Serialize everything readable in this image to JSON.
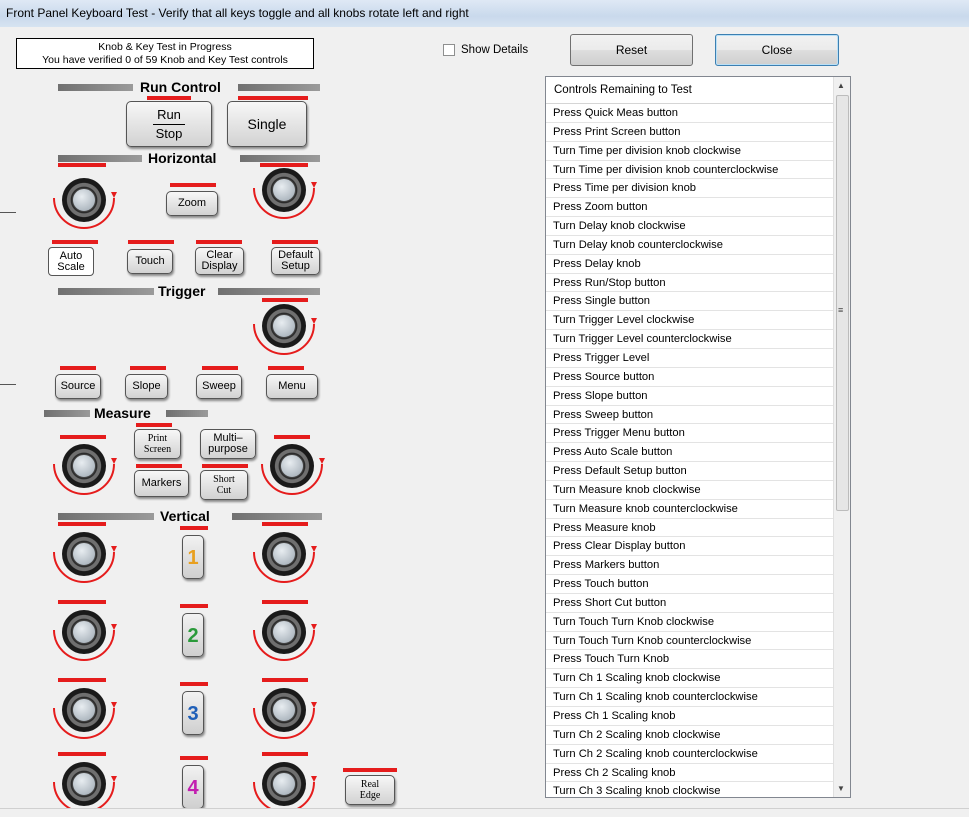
{
  "window": {
    "title": "Front Panel Keyboard Test  - Verify that all keys toggle and all knobs rotate left and right"
  },
  "status": {
    "line1": "Knob & Key Test in Progress",
    "line2": "You have verified 0 of 59 Knob and Key Test controls"
  },
  "show_details": {
    "label": "Show Details",
    "checked": false
  },
  "buttons": {
    "reset": "Reset",
    "close": "Close"
  },
  "panel": {
    "run_control": "Run Control",
    "run": "Run",
    "stop": "Stop",
    "single": "Single",
    "horizontal": "Horizontal",
    "zoom": "Zoom",
    "auto": "Auto",
    "scale": "Scale",
    "touch": "Touch",
    "clear": "Clear",
    "display": "Display",
    "default": "Default",
    "setup": "Setup",
    "trigger": "Trigger",
    "source": "Source",
    "slope": "Slope",
    "sweep": "Sweep",
    "menu": "Menu",
    "measure": "Measure",
    "print": "Print",
    "screen": "Screen",
    "multi": "Multi–",
    "purpose": "purpose",
    "markers": "Markers",
    "short": "Short",
    "cut": "Cut",
    "vertical": "Vertical",
    "ch1": "1",
    "ch2": "2",
    "ch3": "3",
    "ch4": "4",
    "real": "Real",
    "edge": "Edge"
  },
  "colors": {
    "ch1": "#e8a020",
    "ch2": "#2a9a3a",
    "ch3": "#1f5fb8",
    "ch4": "#c21fb0",
    "indicator": "#e51c1c"
  },
  "list": {
    "header": "Controls Remaining to Test",
    "items": [
      "Press Quick Meas button",
      "Press Print Screen button",
      "Turn Time per division knob clockwise",
      "Turn Time per division knob counterclockwise",
      "Press Time per division knob",
      "Press Zoom button",
      "Turn Delay knob clockwise",
      "Turn Delay knob counterclockwise",
      "Press Delay knob",
      "Press Run/Stop button",
      "Press Single button",
      "Turn Trigger Level clockwise",
      "Turn Trigger Level counterclockwise",
      "Press Trigger Level",
      "Press Source button",
      "Press Slope button",
      "Press Sweep button",
      "Press Trigger Menu button",
      "Press Auto Scale button",
      "Press Default Setup button",
      "Turn Measure knob clockwise",
      "Turn Measure knob counterclockwise",
      "Press Measure knob",
      "Press Clear Display button",
      "Press Markers button",
      "Press Touch button",
      "Press Short Cut button",
      "Turn Touch Turn Knob clockwise",
      "Turn Touch Turn Knob counterclockwise",
      "Press Touch Turn Knob",
      "Turn Ch 1 Scaling knob clockwise",
      "Turn Ch 1 Scaling knob counterclockwise",
      "Press Ch 1 Scaling knob",
      "Turn Ch 2 Scaling knob clockwise",
      "Turn Ch 2 Scaling knob counterclockwise",
      "Press Ch 2 Scaling knob",
      "Turn Ch 3 Scaling knob clockwise"
    ]
  }
}
